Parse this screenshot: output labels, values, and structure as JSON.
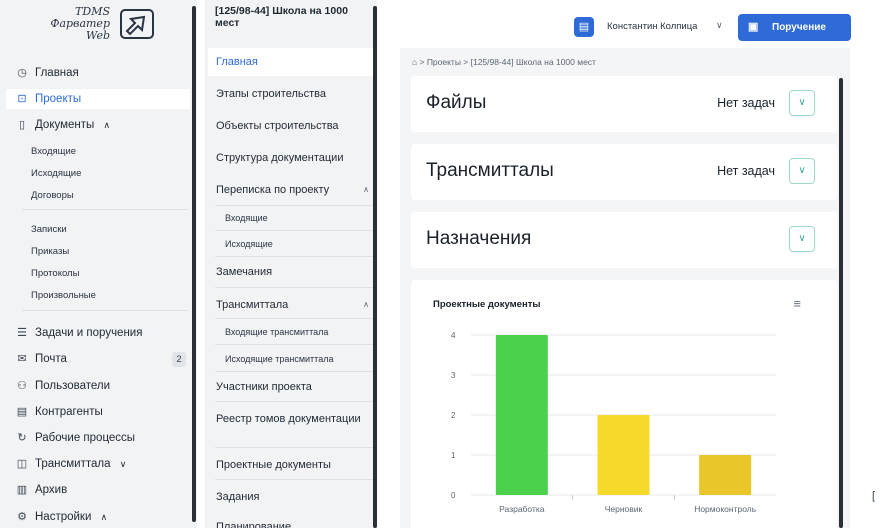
{
  "logo": {
    "line1": "TDMS",
    "line2": "Фарватер",
    "line3": "Web"
  },
  "nav": {
    "items": [
      {
        "label": "Главная",
        "icon": "clock-icon"
      },
      {
        "label": "Проекты",
        "icon": "projects-icon"
      },
      {
        "label": "Документы",
        "icon": "document-icon"
      },
      {
        "label": "Задачи и поручения",
        "icon": "tasks-icon"
      },
      {
        "label": "Почта",
        "icon": "mail-icon",
        "count": "2"
      },
      {
        "label": "Пользователи",
        "icon": "users-icon"
      },
      {
        "label": "Контрагенты",
        "icon": "contractors-icon"
      },
      {
        "label": "Рабочие процессы",
        "icon": "workflow-icon"
      },
      {
        "label": "Трансмиттала",
        "icon": "transmittal-icon"
      },
      {
        "label": "Архив",
        "icon": "archive-icon"
      },
      {
        "label": "Настройки",
        "icon": "gear-icon"
      }
    ],
    "documents_sub": [
      "Входящие",
      "Исходящие",
      "Договоры",
      "Записки",
      "Приказы",
      "Протоколы",
      "Произвольные"
    ],
    "active": "Проекты"
  },
  "menu": {
    "title": "[125/98-44] Школа на 1000 мест",
    "items": [
      "Главная",
      "Этапы строительства",
      "Объекты строительства",
      "Структура документации",
      "Переписка по проекту",
      "Замечания",
      "Трансмиттала",
      "Участники проекта",
      "Реестр томов документации",
      "Проектные документы",
      "Задания",
      "Планирование"
    ],
    "correspondence_sub": [
      "Входящие",
      "Исходящие"
    ],
    "transmittals_sub": [
      "Входящие трансмиттала",
      "Исходящие трансмиттала"
    ]
  },
  "header": {
    "user_name": "Константин Колпица",
    "order_button": "Поручение"
  },
  "breadcrumb": "⌂ > Проекты > [125/98-44] Школа на 1000 мест",
  "cards": [
    {
      "title": "Файлы",
      "status": "Нет задач"
    },
    {
      "title": "Трансмитталы",
      "status": "Нет задач"
    },
    {
      "title": "Назначения",
      "status": ""
    }
  ],
  "colors": {
    "accent": "#2e6bd6",
    "bar_green": "#4cd14c",
    "bar_yellow": "#f6d92a",
    "bar_gold": "#e9c72a"
  },
  "chart_data": {
    "type": "bar",
    "title": "Проектные документы",
    "categories": [
      "Разработка",
      "Черновик",
      "Нормоконтроль"
    ],
    "values": [
      4,
      2,
      1
    ],
    "bar_colors": [
      "#4cd14c",
      "#f6d92a",
      "#e9c72a"
    ],
    "yticks": [
      0,
      1,
      2,
      3,
      4
    ],
    "ylim": [
      0,
      4
    ],
    "grid": true,
    "xlabel": "",
    "ylabel": ""
  }
}
